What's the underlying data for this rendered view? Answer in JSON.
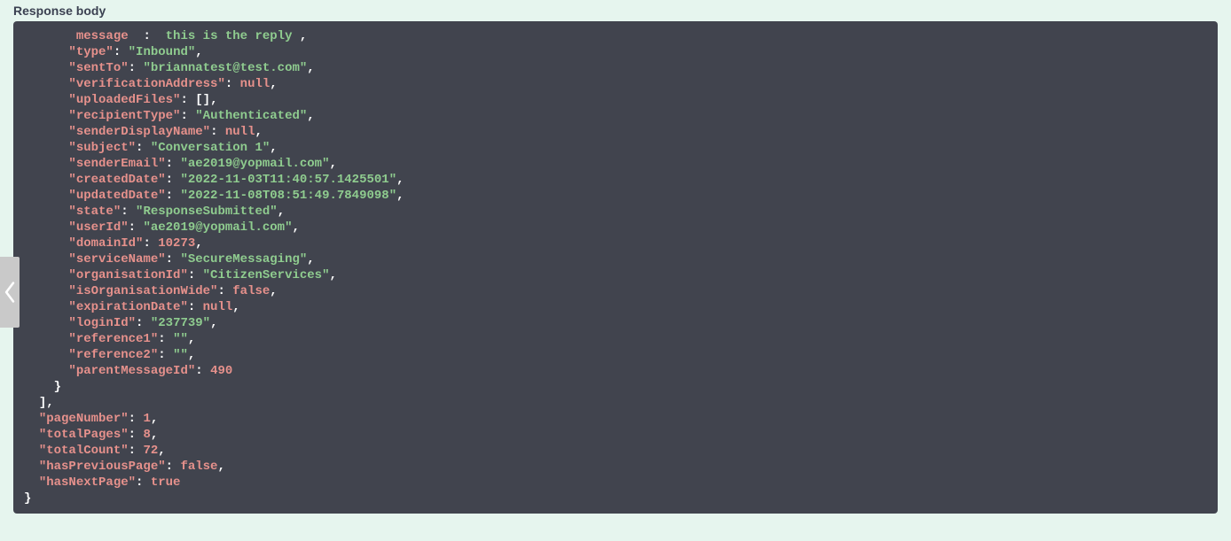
{
  "header": {
    "title": "Response body"
  },
  "json_response": {
    "fields": [
      {
        "key": "message",
        "value": "this is the reply",
        "type": "string",
        "partial_top": true
      },
      {
        "key": "type",
        "value": "Inbound",
        "type": "string"
      },
      {
        "key": "sentTo",
        "value": "briannatest@test.com",
        "type": "string"
      },
      {
        "key": "verificationAddress",
        "value": "null",
        "type": "null"
      },
      {
        "key": "uploadedFiles",
        "value": "[]",
        "type": "array"
      },
      {
        "key": "recipientType",
        "value": "Authenticated",
        "type": "string"
      },
      {
        "key": "senderDisplayName",
        "value": "null",
        "type": "null"
      },
      {
        "key": "subject",
        "value": "Conversation 1",
        "type": "string"
      },
      {
        "key": "senderEmail",
        "value": "ae2019@yopmail.com",
        "type": "string"
      },
      {
        "key": "createdDate",
        "value": "2022-11-03T11:40:57.1425501",
        "type": "string"
      },
      {
        "key": "updatedDate",
        "value": "2022-11-08T08:51:49.7849098",
        "type": "string"
      },
      {
        "key": "state",
        "value": "ResponseSubmitted",
        "type": "string"
      },
      {
        "key": "userId",
        "value": "ae2019@yopmail.com",
        "type": "string"
      },
      {
        "key": "domainId",
        "value": "10273",
        "type": "number"
      },
      {
        "key": "serviceName",
        "value": "SecureMessaging",
        "type": "string"
      },
      {
        "key": "organisationId",
        "value": "CitizenServices",
        "type": "string"
      },
      {
        "key": "isOrganisationWide",
        "value": "false",
        "type": "bool"
      },
      {
        "key": "expirationDate",
        "value": "null",
        "type": "null"
      },
      {
        "key": "loginId",
        "value": "237739",
        "type": "string"
      },
      {
        "key": "reference1",
        "value": "",
        "type": "string"
      },
      {
        "key": "reference2",
        "value": "",
        "type": "string"
      },
      {
        "key": "parentMessageId",
        "value": "490",
        "type": "number",
        "last": true
      }
    ],
    "pagination": [
      {
        "key": "pageNumber",
        "value": "1",
        "type": "number"
      },
      {
        "key": "totalPages",
        "value": "8",
        "type": "number"
      },
      {
        "key": "totalCount",
        "value": "72",
        "type": "number"
      },
      {
        "key": "hasPreviousPage",
        "value": "false",
        "type": "bool"
      },
      {
        "key": "hasNextPage",
        "value": "true",
        "type": "bool",
        "last": true
      }
    ]
  }
}
